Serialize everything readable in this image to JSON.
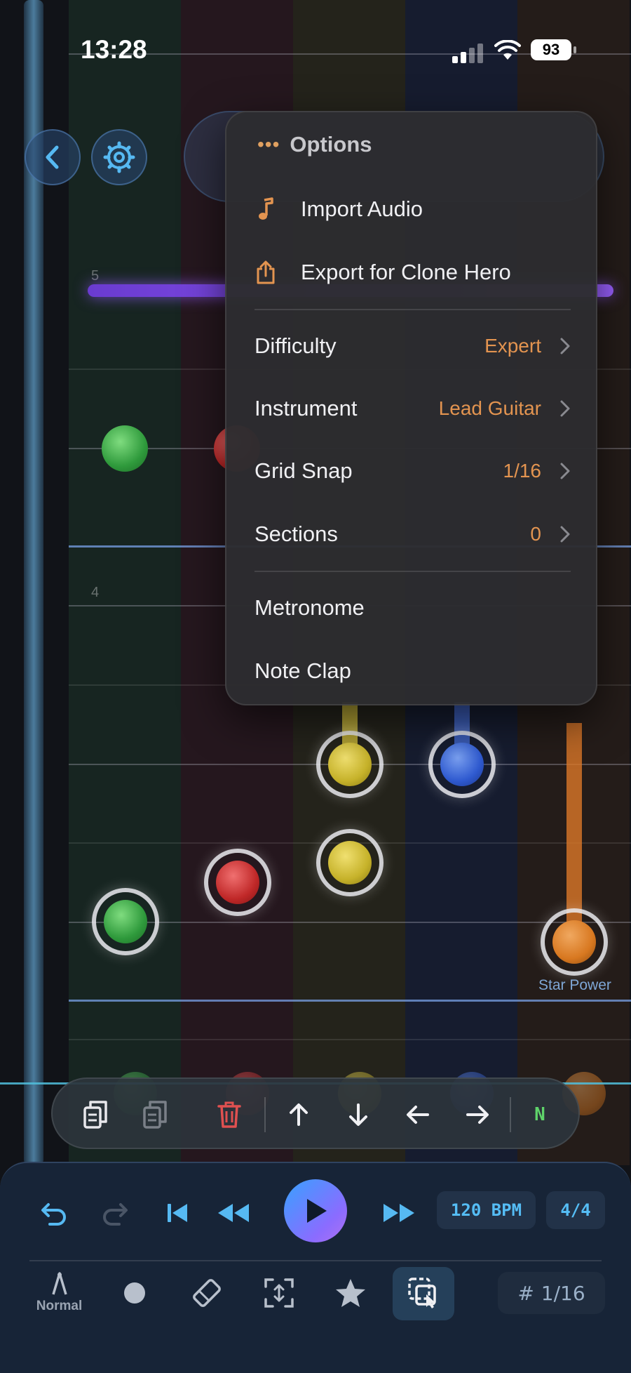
{
  "status_bar": {
    "time": "13:28",
    "battery": "93"
  },
  "menu": {
    "title": "Options",
    "items": [
      {
        "label": "Import Audio",
        "icon": "music-note-icon"
      },
      {
        "label": "Export for Clone Hero",
        "icon": "share-icon"
      }
    ],
    "settings": [
      {
        "label": "Difficulty",
        "value": "Expert"
      },
      {
        "label": "Instrument",
        "value": "Lead Guitar"
      },
      {
        "label": "Grid Snap",
        "value": "1/16"
      },
      {
        "label": "Sections",
        "value": "0"
      }
    ],
    "toggles": [
      {
        "label": "Metronome"
      },
      {
        "label": "Note Clap"
      }
    ]
  },
  "highway": {
    "measure_numbers": [
      "5",
      "4"
    ],
    "star_power_label": "Star Power"
  },
  "edit_toolbar": {
    "buttons": [
      "copy-icon",
      "paste-icon",
      "trash-icon",
      "arrow-up-icon",
      "arrow-down-icon",
      "arrow-left-icon",
      "arrow-right-icon"
    ],
    "note_type_label": "N"
  },
  "transport": {
    "bpm": "120 BPM",
    "time_signature": "4/4"
  },
  "tools": {
    "mode_label": "Normal",
    "grid_label": "1/16",
    "grid_symbol": "#"
  },
  "colors": {
    "accent_orange": "#e39450",
    "accent_blue": "#55bdf5",
    "lane_green": "#2f9a3c",
    "lane_red": "#c02828",
    "lane_yellow": "#c6b22a",
    "lane_blue": "#2f5ad0",
    "lane_orange": "#d87820"
  }
}
